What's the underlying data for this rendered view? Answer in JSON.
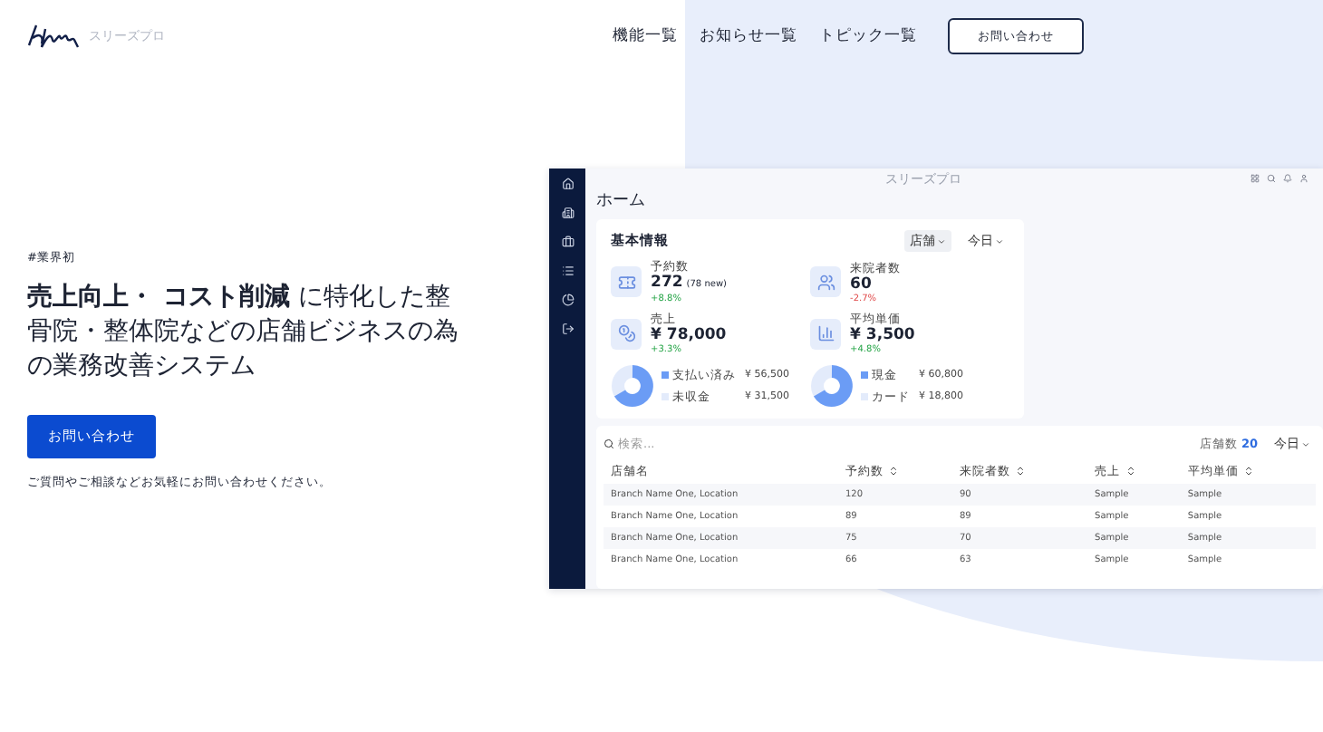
{
  "header": {
    "logo_caption": "スリーズプロ",
    "nav": [
      "機能一覧",
      "お知らせ一覧",
      "トピック一覧"
    ],
    "contact_button": "お問い合わせ"
  },
  "hero": {
    "tag": "#業界初",
    "headline": "**売上向上・ コスト削減** に特化した整骨院・整体院などの店舗ビジネスの為の業務改善システム",
    "cta": "お問い合わせ",
    "note": "ご質問やご相談などお気軽にお問い合わせください。"
  },
  "mockup": {
    "brand_caption": "スリーズプロ",
    "title": "ホーム",
    "summary": {
      "title": "基本情報",
      "filters": [
        "店舗",
        "今日"
      ],
      "stats": [
        {
          "kind": "ticket",
          "label": "予約数",
          "value": "272",
          "unit": "(78 new)",
          "delta": "+8.8%",
          "negative": false
        },
        {
          "kind": "users",
          "label": "来院者数",
          "value": "60",
          "delta": "-2.7%",
          "negative": true
        },
        {
          "kind": "coins",
          "label": "売上",
          "value": "¥ 78,000",
          "delta": "+3.3%",
          "negative": false
        },
        {
          "kind": "chart",
          "label": "平均単価",
          "value": "¥ 3,500",
          "delta": "+4.8%",
          "negative": false
        }
      ],
      "breakdowns": [
        {
          "items": [
            {
              "label": "支払い済み",
              "amount": "¥ 56,500",
              "color": "#6b9cf5"
            },
            {
              "label": "未収金",
              "amount": "¥ 31,500",
              "color": "#e3ebfb"
            }
          ]
        },
        {
          "items": [
            {
              "label": "現金",
              "amount": "¥ 60,800",
              "color": "#6b9cf5"
            },
            {
              "label": "カード",
              "amount": "¥ 18,800",
              "color": "#e3ebfb"
            }
          ]
        }
      ]
    },
    "table": {
      "search_placeholder": "検索...",
      "count_label": "店舗数",
      "count": "20",
      "period": "今日",
      "columns": [
        "店舗名",
        "予約数",
        "来院者数",
        "売上",
        "平均単価"
      ],
      "rows": [
        [
          "Branch Name One, Location",
          "120",
          "90",
          "Sample",
          "Sample"
        ],
        [
          "Branch Name One, Location",
          "89",
          "89",
          "Sample",
          "Sample"
        ],
        [
          "Branch Name One, Location",
          "75",
          "70",
          "Sample",
          "Sample"
        ],
        [
          "Branch Name One, Location",
          "66",
          "63",
          "Sample",
          "Sample"
        ]
      ]
    }
  }
}
